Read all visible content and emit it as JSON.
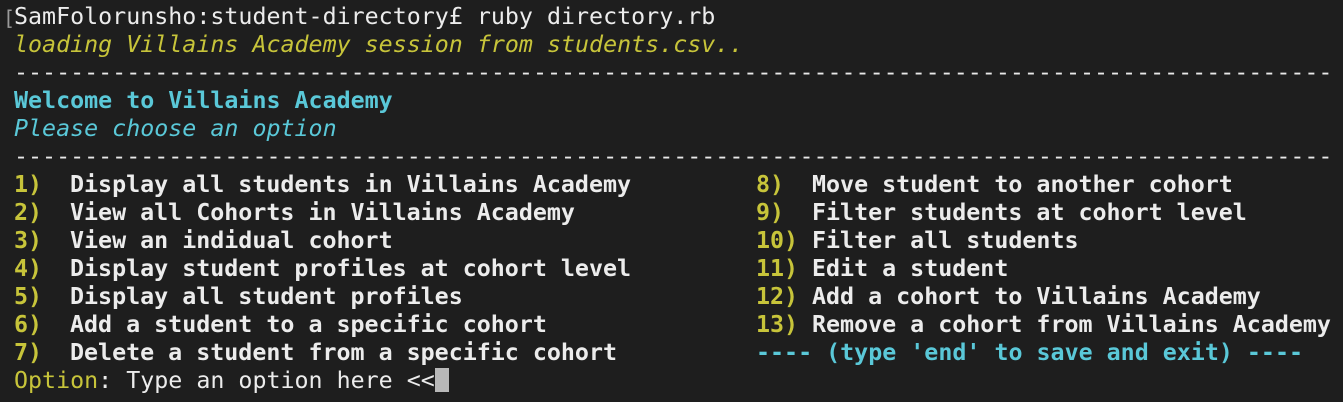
{
  "terminal": {
    "command_line": "SamFolorunsho:student-directory£ ruby directory.rb",
    "loading": "loading Villains Academy session from students.csv..",
    "rule": "----------------------------------------------------------------------------------------------",
    "welcome": "Welcome to Villains Academy",
    "choose": "Please choose an option",
    "menu_left": [
      {
        "num": "1)",
        "label": "Display all students in Villains Academy"
      },
      {
        "num": "2)",
        "label": "View all Cohorts in Villains Academy"
      },
      {
        "num": "3)",
        "label": "View an indidual cohort"
      },
      {
        "num": "4)",
        "label": "Display student profiles at cohort level"
      },
      {
        "num": "5)",
        "label": "Display all student profiles"
      },
      {
        "num": "6)",
        "label": "Add a student to a specific cohort"
      },
      {
        "num": "7)",
        "label": "Delete a student from a specific cohort"
      }
    ],
    "menu_right": [
      {
        "num": "8)",
        "label": "Move student to another cohort"
      },
      {
        "num": "9)",
        "label": "Filter students at cohort level"
      },
      {
        "num": "10)",
        "label": "Filter all students"
      },
      {
        "num": "11)",
        "label": "Edit a student"
      },
      {
        "num": "12)",
        "label": "Add a cohort to Villains Academy"
      },
      {
        "num": "13)",
        "label": "Remove a cohort from Villains Academy"
      }
    ],
    "footer_note": "---- (type 'end' to save and exit) ----",
    "option_label": "Option",
    "option_rest": ": Type an option here <<"
  },
  "colors": {
    "background": "#1e1e1e",
    "text": "#ececec",
    "yellow": "#c7c43a",
    "cyan": "#5ac8d8"
  }
}
